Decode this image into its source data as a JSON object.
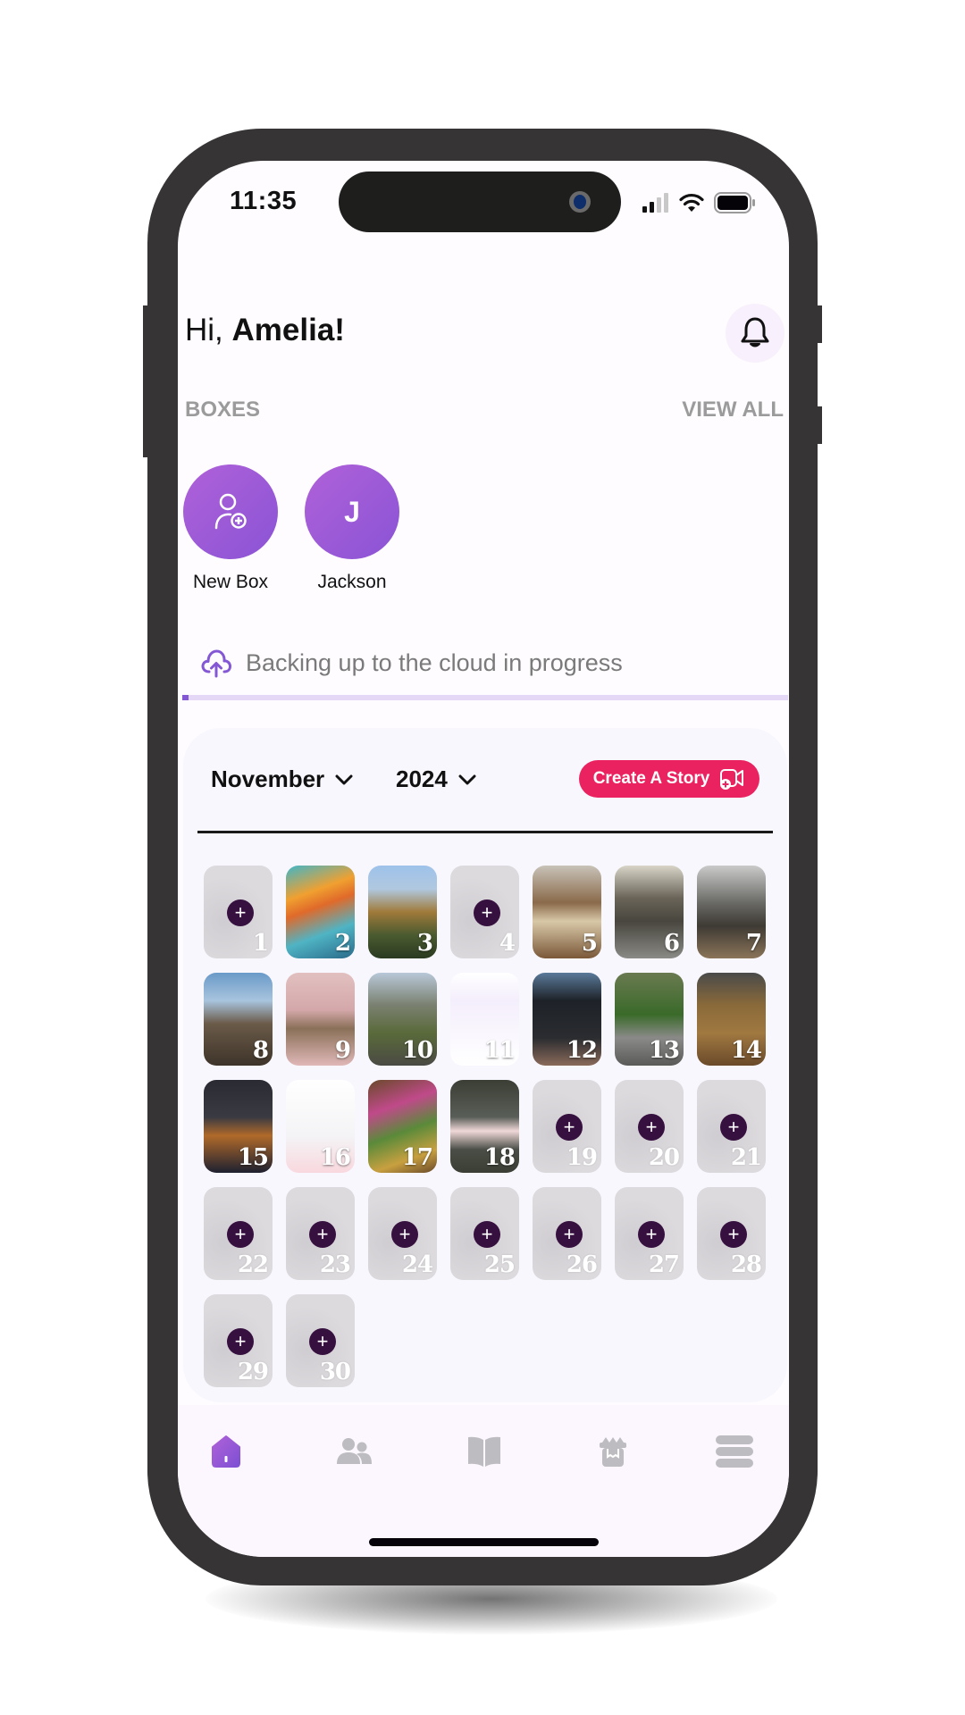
{
  "status_bar": {
    "time": "11:35"
  },
  "header": {
    "greeting_prefix": "Hi,",
    "user_name": "Amelia!",
    "bell_icon": "bell-icon"
  },
  "boxes": {
    "section_label": "BOXES",
    "view_all_label": "VIEW ALL",
    "items": [
      {
        "label": "New Box",
        "icon": "add-user-icon",
        "initial": ""
      },
      {
        "label": "Jackson",
        "icon": "",
        "initial": "J"
      }
    ]
  },
  "backup": {
    "icon": "cloud-upload-icon",
    "text": "Backing up to the cloud in progress",
    "progress_percent": 1
  },
  "calendar": {
    "month": "November",
    "year": "2024",
    "create_story_label": "Create A Story",
    "create_story_icon": "video-add-icon",
    "days": [
      {
        "day": "1",
        "has_photo": false,
        "thumb": ""
      },
      {
        "day": "2",
        "has_photo": true,
        "thumb": "colorful-cartoon-art"
      },
      {
        "day": "3",
        "has_photo": true,
        "thumb": "monument-trees"
      },
      {
        "day": "4",
        "has_photo": false,
        "thumb": ""
      },
      {
        "day": "5",
        "has_photo": true,
        "thumb": "hand-holding-device"
      },
      {
        "day": "6",
        "has_photo": true,
        "thumb": "cafe-umbrella"
      },
      {
        "day": "7",
        "has_photo": true,
        "thumb": "restaurant-interior"
      },
      {
        "day": "8",
        "has_photo": true,
        "thumb": "building-sky"
      },
      {
        "day": "9",
        "has_photo": true,
        "thumb": "pink-boxes-shelf"
      },
      {
        "day": "10",
        "has_photo": true,
        "thumb": "garden-trees"
      },
      {
        "day": "11",
        "has_photo": true,
        "thumb": "app-screenshot"
      },
      {
        "day": "12",
        "has_photo": true,
        "thumb": "dark-app-screenshot"
      },
      {
        "day": "13",
        "has_photo": true,
        "thumb": "black-cats-lawn"
      },
      {
        "day": "14",
        "has_photo": true,
        "thumb": "puzzle-table"
      },
      {
        "day": "15",
        "has_photo": true,
        "thumb": "movie-poster"
      },
      {
        "day": "16",
        "has_photo": true,
        "thumb": "chat-app-screenshot"
      },
      {
        "day": "17",
        "has_photo": true,
        "thumb": "puzzle-art"
      },
      {
        "day": "18",
        "has_photo": true,
        "thumb": "phone-notification"
      },
      {
        "day": "19",
        "has_photo": false,
        "thumb": ""
      },
      {
        "day": "20",
        "has_photo": false,
        "thumb": ""
      },
      {
        "day": "21",
        "has_photo": false,
        "thumb": ""
      },
      {
        "day": "22",
        "has_photo": false,
        "thumb": ""
      },
      {
        "day": "23",
        "has_photo": false,
        "thumb": ""
      },
      {
        "day": "24",
        "has_photo": false,
        "thumb": ""
      },
      {
        "day": "25",
        "has_photo": false,
        "thumb": ""
      },
      {
        "day": "26",
        "has_photo": false,
        "thumb": ""
      },
      {
        "day": "27",
        "has_photo": false,
        "thumb": ""
      },
      {
        "day": "28",
        "has_photo": false,
        "thumb": ""
      },
      {
        "day": "29",
        "has_photo": false,
        "thumb": ""
      },
      {
        "day": "30",
        "has_photo": false,
        "thumb": ""
      }
    ]
  },
  "bottom_nav": {
    "items": [
      {
        "name": "home",
        "icon": "home-icon",
        "active": true
      },
      {
        "name": "people",
        "icon": "people-icon",
        "active": false
      },
      {
        "name": "stories",
        "icon": "book-icon",
        "active": false
      },
      {
        "name": "gifts",
        "icon": "gift-icon",
        "active": false
      },
      {
        "name": "menu",
        "icon": "menu-icon",
        "active": false
      }
    ]
  },
  "colors": {
    "accent_purple": "#8a54d6",
    "create_story_pink": "#ea2260",
    "plus_button": "#36103f",
    "inactive_nav": "#bdbcc0"
  }
}
